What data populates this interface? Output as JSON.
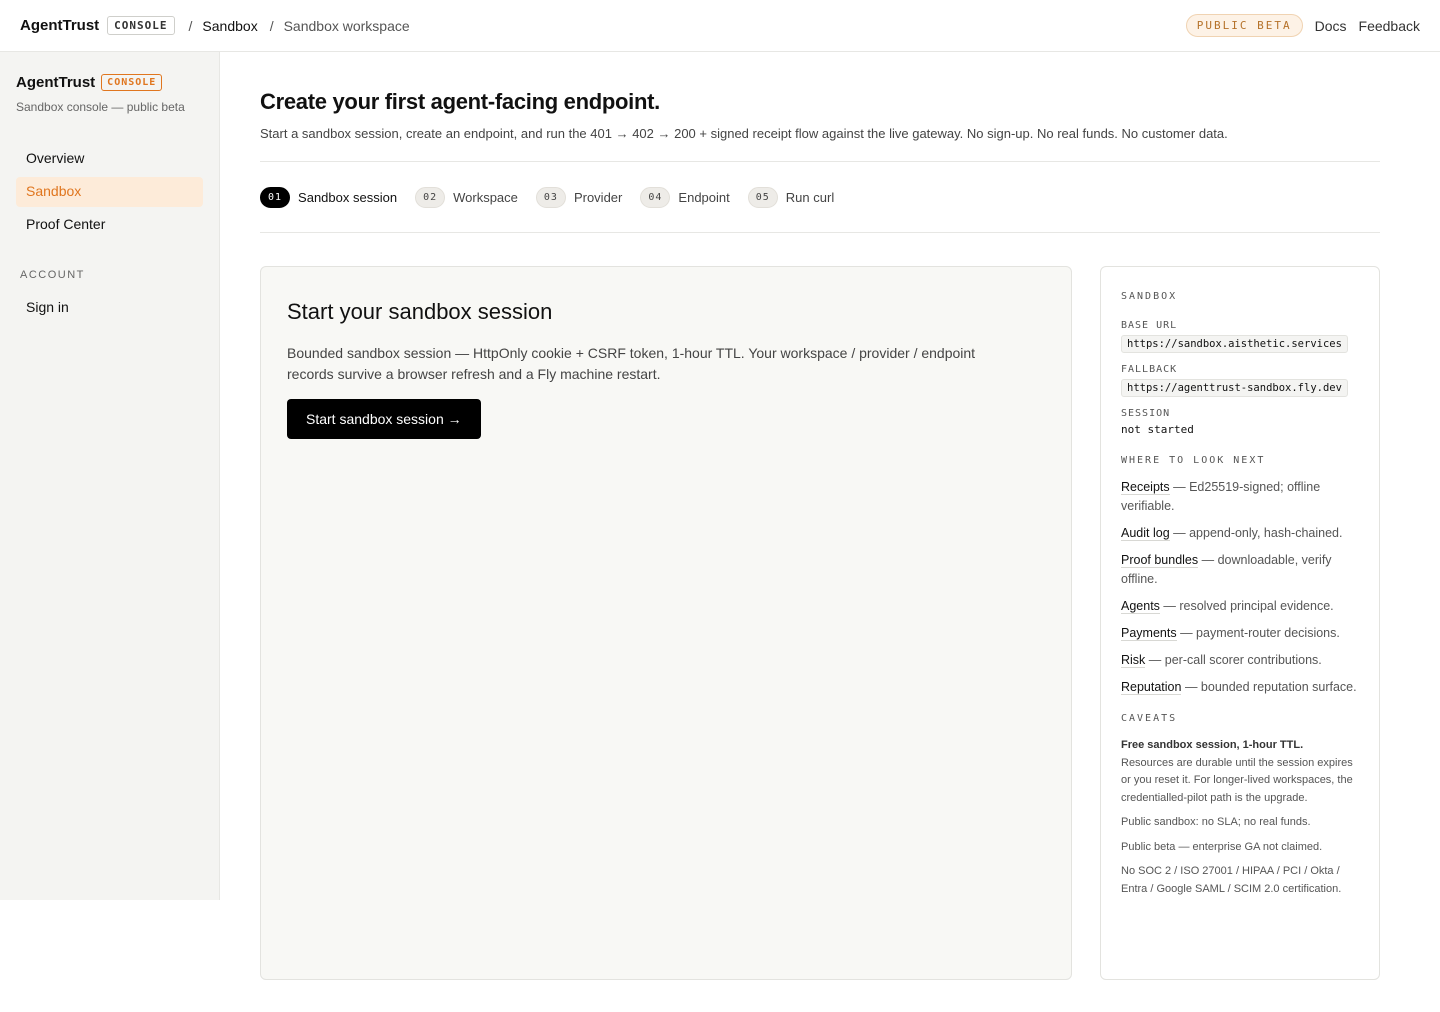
{
  "topbar": {
    "brand": "AgentTrust",
    "console_tag": "CONSOLE",
    "breadcrumb": [
      "Sandbox",
      "Sandbox workspace"
    ],
    "sep": "/",
    "beta_badge": "PUBLIC BETA",
    "links": [
      "Docs",
      "Feedback"
    ]
  },
  "sidebar": {
    "brand": "AgentTrust",
    "console_tag": "CONSOLE",
    "subtitle": "Sandbox console — public beta",
    "items": [
      {
        "label": "Overview",
        "active": false
      },
      {
        "label": "Sandbox",
        "active": true
      },
      {
        "label": "Proof Center",
        "active": false
      }
    ],
    "account_heading": "ACCOUNT",
    "account_items": [
      {
        "label": "Sign in"
      }
    ],
    "accent_color": "#e0761f"
  },
  "main": {
    "title": "Create your first agent-facing endpoint.",
    "intro": "Start a sandbox session, create an endpoint, and run the 401 → 402 → 200 + signed receipt flow against the live gateway. No sign-up. No real funds. No customer data.",
    "steps": [
      {
        "num": "01",
        "label": "Sandbox session",
        "active": true
      },
      {
        "num": "02",
        "label": "Workspace",
        "active": false
      },
      {
        "num": "03",
        "label": "Provider",
        "active": false
      },
      {
        "num": "04",
        "label": "Endpoint",
        "active": false
      },
      {
        "num": "05",
        "label": "Run curl",
        "active": false
      }
    ],
    "card": {
      "title": "Start your sandbox session",
      "description": "Bounded sandbox session — HttpOnly cookie + CSRF token, 1-hour TTL. Your workspace / provider / endpoint records survive a browser refresh and a Fly machine restart.",
      "button": "Start sandbox session →"
    }
  },
  "panel": {
    "heading": "SANDBOX",
    "base_url_label": "BASE URL",
    "base_url": "https://sandbox.aisthetic.services",
    "fallback_label": "FALLBACK",
    "fallback": "https://agenttrust-sandbox.fly.dev",
    "session_label": "SESSION",
    "session": "not started",
    "look_heading": "WHERE TO LOOK NEXT",
    "look_items": [
      {
        "key": "Receipts",
        "text": " — Ed25519-signed; offline verifiable."
      },
      {
        "key": "Audit log",
        "text": " — append-only, hash-chained."
      },
      {
        "key": "Proof bundles",
        "text": " — downloadable, verify offline."
      },
      {
        "key": "Agents",
        "text": " — resolved principal evidence."
      },
      {
        "key": "Payments",
        "text": " — payment-router decisions."
      },
      {
        "key": "Risk",
        "text": " — per-call scorer contributions."
      },
      {
        "key": "Reputation",
        "text": " — bounded reputation surface."
      }
    ],
    "caveats_heading": "CAVEATS",
    "caveat_bold": "Free sandbox session, 1-hour TTL.",
    "caveat_first": "Resources are durable until the session expires or you reset it. For longer-lived workspaces, the credentialled-pilot path is the upgrade.",
    "caveats": [
      "Public sandbox: no SLA; no real funds.",
      "Public beta — enterprise GA not claimed.",
      "No SOC 2 / ISO 27001 / HIPAA / PCI / Okta / Entra / Google SAML / SCIM 2.0 certification."
    ]
  }
}
